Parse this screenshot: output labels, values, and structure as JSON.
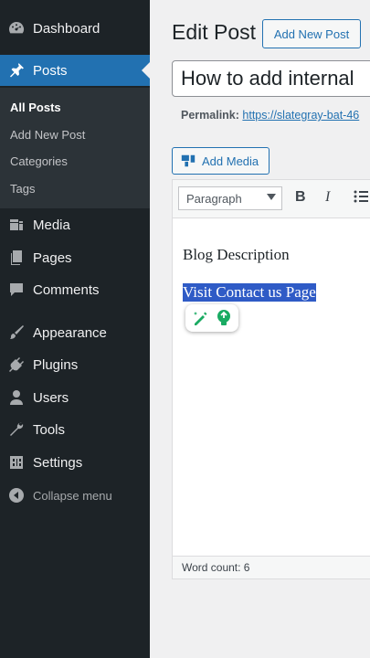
{
  "sidebar": {
    "items": [
      {
        "label": "Dashboard",
        "icon": "dashboard-icon"
      },
      {
        "label": "Posts",
        "icon": "pushpin-icon",
        "active": true
      },
      {
        "label": "Media",
        "icon": "media-icon"
      },
      {
        "label": "Pages",
        "icon": "pages-icon"
      },
      {
        "label": "Comments",
        "icon": "comment-icon"
      },
      {
        "label": "Appearance",
        "icon": "paintbrush-icon"
      },
      {
        "label": "Plugins",
        "icon": "plugin-icon"
      },
      {
        "label": "Users",
        "icon": "user-icon"
      },
      {
        "label": "Tools",
        "icon": "wrench-icon"
      },
      {
        "label": "Settings",
        "icon": "settings-icon"
      }
    ],
    "submenu": [
      "All Posts",
      "Add New Post",
      "Categories",
      "Tags"
    ],
    "collapse_label": "Collapse menu",
    "accent": "#2271b1"
  },
  "page": {
    "title": "Edit Post",
    "add_new_label": "Add New Post",
    "post_title": "How to add internal",
    "permalink_label": "Permalink:",
    "permalink_url": "https://slategray-bat-46"
  },
  "editor": {
    "add_media_label": "Add Media",
    "format_value": "Paragraph",
    "bold_label": "B",
    "italic_label": "I",
    "paragraphs": [
      "Blog Description",
      "Visit Contact us Page"
    ],
    "word_count": "Word count: 6",
    "selection_color": "#2f5bc6"
  }
}
